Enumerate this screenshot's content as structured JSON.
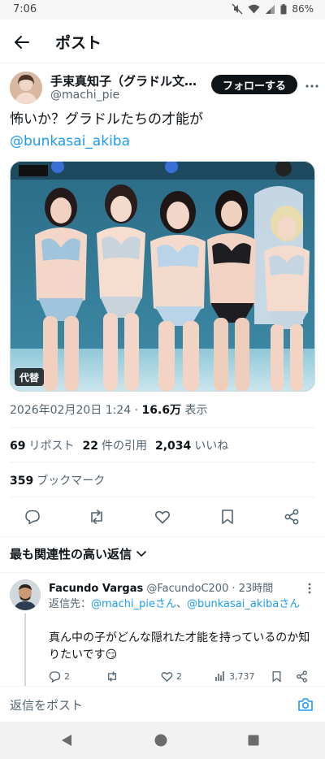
{
  "status_bar": {
    "time": "7:06",
    "battery": "86%",
    "icons": [
      "mute-icon",
      "wifi-icon",
      "signal-icon",
      "battery-icon"
    ]
  },
  "header": {
    "title": "ポスト",
    "back_icon": "arrow-left-icon"
  },
  "author": {
    "name": "手束真知子（グラドル文化祭@AKIBAカルチャーズ劇場）",
    "handle": "@machi_pie",
    "follow_label": "フォローする",
    "more_icon": "ellipsis-icon"
  },
  "post": {
    "text": "怖いか？グラドルたちの才能が",
    "mention": "@bunkasai_akiba",
    "media_alt_badge": "代替",
    "date": "2026年02月20日 1:24",
    "views_value": "16.6万",
    "views_label": "表示"
  },
  "stats": {
    "reposts_value": "69",
    "reposts_label": "リポスト",
    "quotes_value": "22",
    "quotes_label": "件の引用",
    "likes_value": "2,034",
    "likes_label": "いいね",
    "bookmarks_value": "359",
    "bookmarks_label": "ブックマーク"
  },
  "actions": [
    "reply-icon",
    "repost-icon",
    "like-icon",
    "bookmark-icon",
    "share-icon"
  ],
  "replies_section": {
    "sort_label": "最も関連性の高い返信"
  },
  "reply": {
    "name": "Facundo Vargas",
    "handle": "@FacundoC200",
    "time": "23時間",
    "reply_to_prefix": "返信先：",
    "reply_to_user1": "@machi_pieさん",
    "reply_to_separator": "、",
    "reply_to_user2": "@bunkasai_akibaさん",
    "text": "真ん中の子がどんな隠れた才能を持っているのか知りたいです😏",
    "reply_count": "2",
    "like_count": "2",
    "view_count": "3,737"
  },
  "compose": {
    "placeholder": "返信をポスト"
  },
  "colors": {
    "accent": "#1d9bf0",
    "text": "#0f1419",
    "muted": "#536471",
    "divider": "#eff3f4",
    "follow_bg": "#0f1419"
  }
}
